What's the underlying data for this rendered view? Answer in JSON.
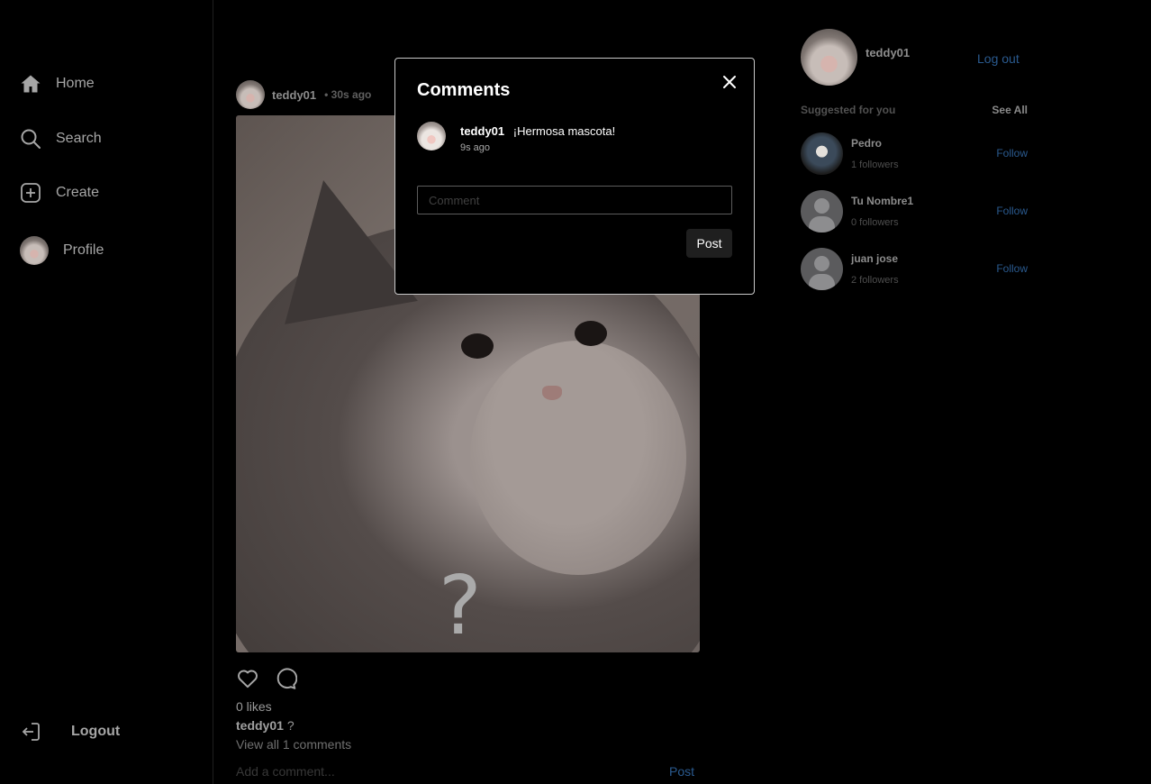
{
  "sidebar": {
    "items": [
      {
        "label": "Home",
        "icon": "home-icon"
      },
      {
        "label": "Search",
        "icon": "search-icon"
      },
      {
        "label": "Create",
        "icon": "plus-square-icon"
      },
      {
        "label": "Profile",
        "icon": "avatar"
      }
    ],
    "logout_label": "Logout"
  },
  "post": {
    "username": "teddy01",
    "time": "• 30s ago",
    "image_mark": "?",
    "likes": "0 likes",
    "caption_user": "teddy01",
    "caption_text": "?",
    "view_all": "View all 1 comments",
    "add_comment_placeholder": "Add a comment...",
    "post_label": "Post"
  },
  "right": {
    "username": "teddy01",
    "logout": "Log out",
    "suggested_title": "Suggested for you",
    "see_all": "See All",
    "suggestions": [
      {
        "name": "Pedro",
        "followers": "1 followers",
        "follow": "Follow"
      },
      {
        "name": "Tu Nombre1",
        "followers": "0 followers",
        "follow": "Follow"
      },
      {
        "name": "juan jose",
        "followers": "2 followers",
        "follow": "Follow"
      }
    ]
  },
  "modal": {
    "title": "Comments",
    "comments": [
      {
        "user": "teddy01",
        "text": "¡Hermosa mascota!",
        "time": "9s ago"
      }
    ],
    "input_placeholder": "Comment",
    "post_label": "Post"
  },
  "colors": {
    "background": "#000000",
    "link_blue": "#2a5a8f",
    "modal_border": "#c9c9c9",
    "muted_text": "#a6a6a6"
  }
}
